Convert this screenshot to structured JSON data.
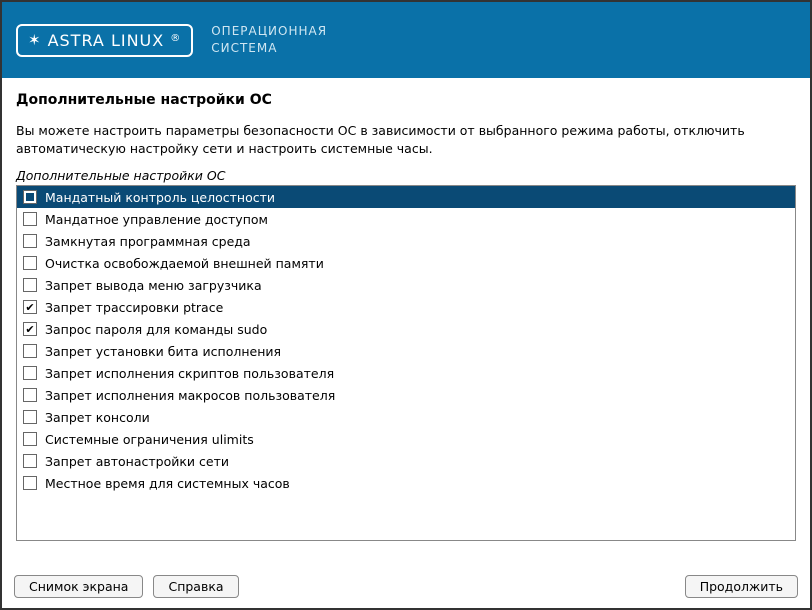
{
  "header": {
    "logo_text": "ASTRA LINUX",
    "logo_suffix": "®",
    "subtitle_line1": "ОПЕРАЦИОННАЯ",
    "subtitle_line2": "СИСТЕМА"
  },
  "page": {
    "title": "Дополнительные настройки ОС",
    "description": "Вы можете настроить параметры безопасности ОС в зависимости от выбранного режима работы, отключить автоматическую настройку сети и настроить системные часы.",
    "section_label": "Дополнительные настройки ОС"
  },
  "options": [
    {
      "label": "Мандатный контроль целостности",
      "checked": true,
      "selected": true
    },
    {
      "label": "Мандатное управление доступом",
      "checked": false,
      "selected": false
    },
    {
      "label": "Замкнутая программная среда",
      "checked": false,
      "selected": false
    },
    {
      "label": "Очистка освобождаемой внешней памяти",
      "checked": false,
      "selected": false
    },
    {
      "label": "Запрет вывода меню загрузчика",
      "checked": false,
      "selected": false
    },
    {
      "label": "Запрет трассировки ptrace",
      "checked": true,
      "selected": false
    },
    {
      "label": "Запрос пароля для команды sudo",
      "checked": true,
      "selected": false
    },
    {
      "label": "Запрет установки бита исполнения",
      "checked": false,
      "selected": false
    },
    {
      "label": "Запрет исполнения скриптов пользователя",
      "checked": false,
      "selected": false
    },
    {
      "label": "Запрет исполнения макросов пользователя",
      "checked": false,
      "selected": false
    },
    {
      "label": "Запрет консоли",
      "checked": false,
      "selected": false
    },
    {
      "label": "Системные ограничения ulimits",
      "checked": false,
      "selected": false
    },
    {
      "label": "Запрет автонастройки сети",
      "checked": false,
      "selected": false
    },
    {
      "label": "Местное время для системных часов",
      "checked": false,
      "selected": false
    }
  ],
  "footer": {
    "screenshot": "Снимок экрана",
    "help": "Справка",
    "continue": "Продолжить"
  }
}
